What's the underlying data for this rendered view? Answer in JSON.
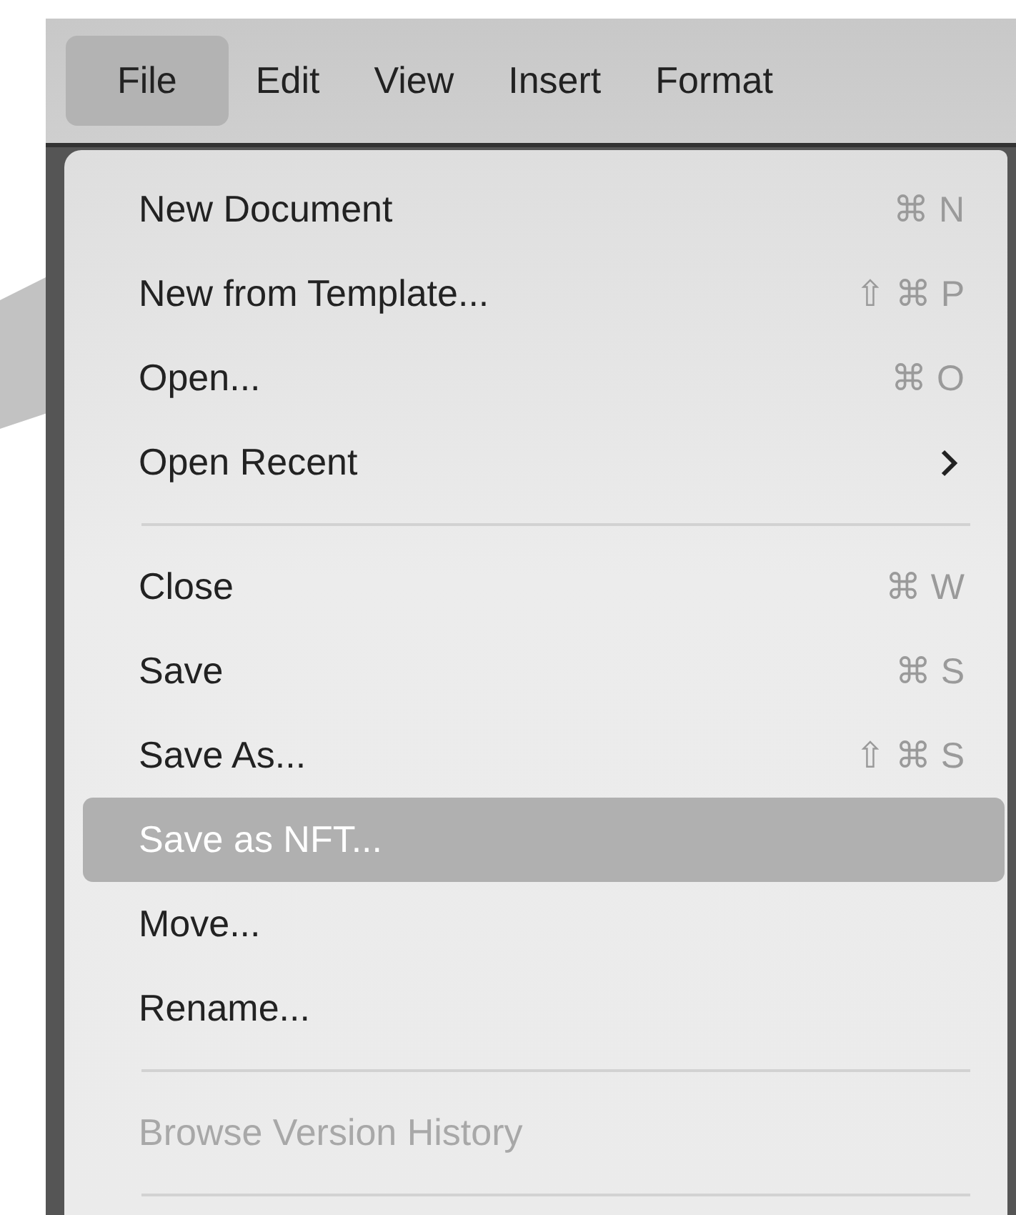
{
  "menu_bar": {
    "items": [
      {
        "label": "File",
        "selected": true
      },
      {
        "label": "Edit",
        "selected": false
      },
      {
        "label": "View",
        "selected": false
      },
      {
        "label": "Insert",
        "selected": false
      },
      {
        "label": "Format",
        "selected": false
      }
    ]
  },
  "file_menu": {
    "items": [
      {
        "kind": "item",
        "label": "New Document",
        "shortcut": "⌘ N",
        "selected": false,
        "disabled": false
      },
      {
        "kind": "item",
        "label": "New from Template...",
        "shortcut": "⇧ ⌘ P",
        "selected": false,
        "disabled": false
      },
      {
        "kind": "item",
        "label": "Open...",
        "shortcut": "⌘ O",
        "selected": false,
        "disabled": false
      },
      {
        "kind": "submenu",
        "label": "Open Recent",
        "selected": false,
        "disabled": false
      },
      {
        "kind": "separator"
      },
      {
        "kind": "item",
        "label": "Close",
        "shortcut": "⌘ W",
        "selected": false,
        "disabled": false
      },
      {
        "kind": "item",
        "label": "Save",
        "shortcut": "⌘ S",
        "selected": false,
        "disabled": false
      },
      {
        "kind": "item",
        "label": "Save As...",
        "shortcut": "⇧ ⌘ S",
        "selected": false,
        "disabled": false
      },
      {
        "kind": "item",
        "label": "Save as NFT...",
        "selected": true,
        "disabled": false
      },
      {
        "kind": "item",
        "label": "Move...",
        "selected": false,
        "disabled": false
      },
      {
        "kind": "item",
        "label": "Rename...",
        "selected": false,
        "disabled": false
      },
      {
        "kind": "separator"
      },
      {
        "kind": "item",
        "label": "Browse Version History",
        "selected": false,
        "disabled": true
      },
      {
        "kind": "separator"
      }
    ]
  }
}
